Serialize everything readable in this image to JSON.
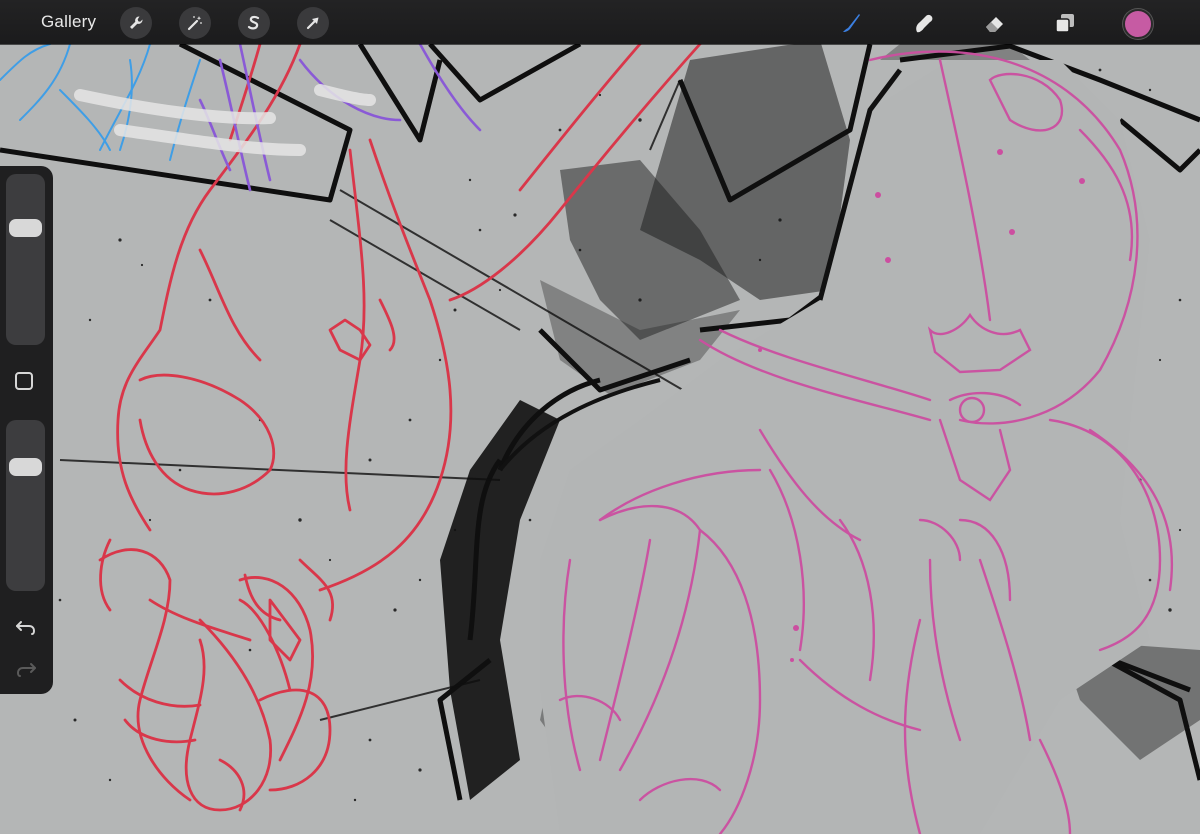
{
  "app": {
    "gallery_label": "Gallery"
  },
  "toolbar": {
    "left_tools": [
      {
        "name": "actions",
        "icon": "wrench-icon"
      },
      {
        "name": "adjustments",
        "icon": "magic-wand-icon"
      },
      {
        "name": "selection",
        "icon": "selection-s-icon"
      },
      {
        "name": "transform",
        "icon": "arrow-cursor-icon"
      }
    ],
    "right_tools": [
      {
        "name": "brush",
        "icon": "brush-icon",
        "active": true
      },
      {
        "name": "smudge",
        "icon": "smudge-icon",
        "active": false
      },
      {
        "name": "eraser",
        "icon": "eraser-icon",
        "active": false
      },
      {
        "name": "layers",
        "icon": "layers-icon",
        "active": false
      }
    ],
    "current_color": "#c65ba3",
    "active_color": "#3b7fe0"
  },
  "sidebar": {
    "brush_size_level": 0.72,
    "opacity_level": 0.77,
    "icons": [
      "modify-square-icon",
      "undo-icon",
      "redo-icon"
    ]
  },
  "canvas": {
    "background": "#b4b6b6",
    "stroke_colors": {
      "red": "#d9374a",
      "pink": "#cc4ea0",
      "purple": "#8a5ad6",
      "blue": "#3f9ee6",
      "black": "#121212"
    }
  }
}
